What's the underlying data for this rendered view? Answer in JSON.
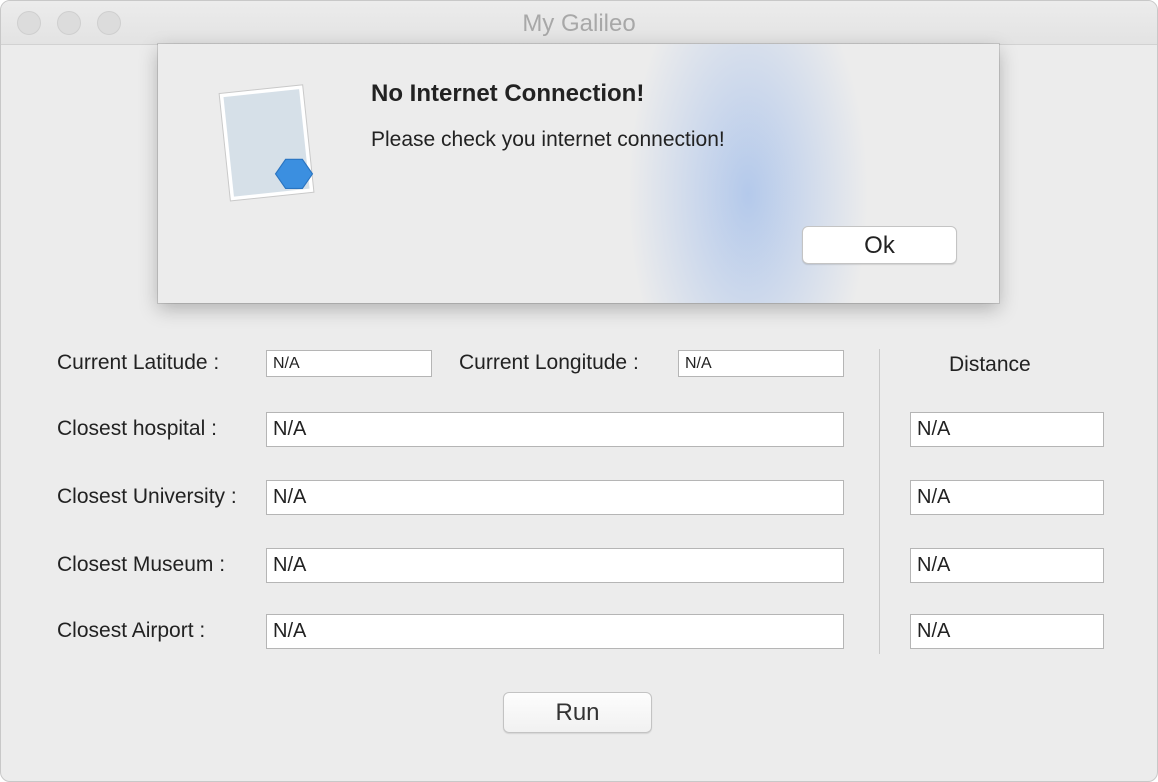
{
  "window": {
    "title": "My Galileo"
  },
  "alert": {
    "title": "No Internet Connection!",
    "message": "Please check you internet connection!",
    "ok_label": "Ok",
    "icon": "app-map-icon"
  },
  "form": {
    "latitude_label": "Current Latitude :",
    "latitude_value": "N/A",
    "longitude_label": "Current Longitude :",
    "longitude_value": "N/A",
    "distance_header": "Distance",
    "rows": [
      {
        "label": "Closest hospital :",
        "value": "N/A",
        "distance": "N/A"
      },
      {
        "label": "Closest University :",
        "value": "N/A",
        "distance": "N/A"
      },
      {
        "label": "Closest Museum :",
        "value": "N/A",
        "distance": "N/A"
      },
      {
        "label": "Closest Airport :",
        "value": "N/A",
        "distance": "N/A"
      }
    ],
    "run_label": "Run"
  },
  "colors": {
    "window_bg": "#ececec",
    "title_text": "#a8a8a8",
    "icon_blue": "#3b8fe0",
    "icon_paper": "#d6e0e8"
  }
}
